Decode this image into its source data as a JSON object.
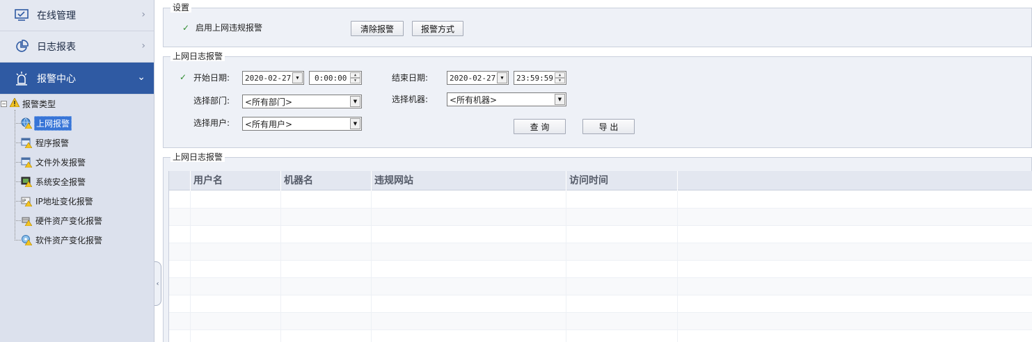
{
  "sidebar": {
    "nav": [
      {
        "label": "在线管理",
        "icon": "monitor-icon",
        "active": false
      },
      {
        "label": "日志报表",
        "icon": "pie-chart-icon",
        "active": false
      },
      {
        "label": "报警中心",
        "icon": "alarm-icon",
        "active": true
      }
    ],
    "tree": {
      "root_label": "报警类型",
      "children": [
        {
          "label": "上网报警",
          "icon": "globe-warning-icon",
          "selected": true
        },
        {
          "label": "程序报警",
          "icon": "window-warning-icon",
          "selected": false
        },
        {
          "label": "文件外发报警",
          "icon": "window-warning-icon",
          "selected": false
        },
        {
          "label": "系统安全报警",
          "icon": "system-warning-icon",
          "selected": false
        },
        {
          "label": "IP地址变化报警",
          "icon": "ip-warning-icon",
          "selected": false
        },
        {
          "label": "硬件资产变化报警",
          "icon": "hardware-warning-icon",
          "selected": false
        },
        {
          "label": "软件资产变化报警",
          "icon": "software-warning-icon",
          "selected": false
        }
      ]
    }
  },
  "settings": {
    "title": "设置",
    "enable_label": "启用上网违规报警",
    "enable_checked": true,
    "clear_button": "清除报警",
    "method_button": "报警方式"
  },
  "filter": {
    "title": "上网日志报警",
    "start_checked": true,
    "start_label": "开始日期:",
    "start_date": "2020-02-27",
    "start_time": "0:00:00",
    "end_label": "结束日期:",
    "end_date": "2020-02-27",
    "end_time": "23:59:59",
    "dept_label": "选择部门:",
    "dept_value": "<所有部门>",
    "machine_label": "选择机器:",
    "machine_value": "<所有机器>",
    "user_label": "选择用户:",
    "user_value": "<所有用户>",
    "query_button": "查 询",
    "export_button": "导 出"
  },
  "results": {
    "title": "上网日志报警",
    "columns": [
      "用户名",
      "机器名",
      "违规网站",
      "访问时间"
    ],
    "rows": []
  },
  "colors": {
    "accent": "#2f5aa3",
    "selection": "#3875d7",
    "check": "#2e8b2e"
  }
}
